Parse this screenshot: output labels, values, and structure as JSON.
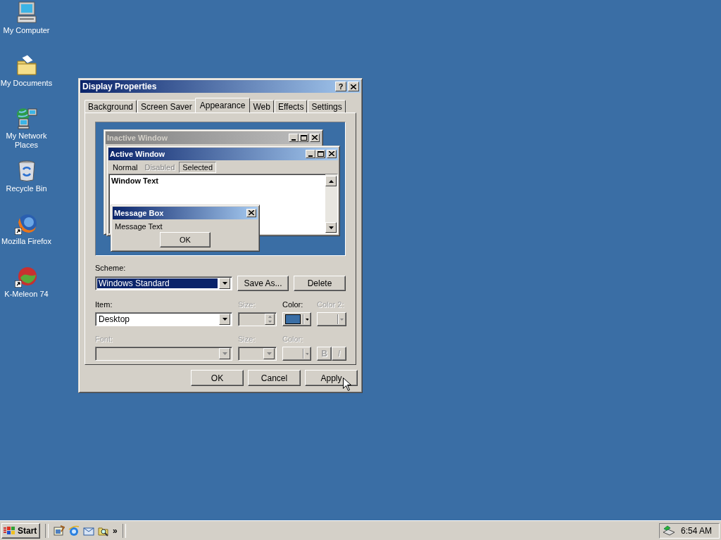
{
  "desktop_icons": [
    {
      "label": "My Computer",
      "kind": "computer",
      "shortcut": false
    },
    {
      "label": "My Documents",
      "kind": "documents",
      "shortcut": false
    },
    {
      "label": "My Network Places",
      "kind": "network",
      "shortcut": false
    },
    {
      "label": "Recycle Bin",
      "kind": "recycle",
      "shortcut": false
    },
    {
      "label": "Mozilla Firefox",
      "kind": "firefox",
      "shortcut": true
    },
    {
      "label": "K-Meleon 74",
      "kind": "kmeleon",
      "shortcut": true
    }
  ],
  "dialog": {
    "title": "Display Properties",
    "help": "?",
    "tabs": [
      {
        "label": "Background",
        "selected": false
      },
      {
        "label": "Screen Saver",
        "selected": false
      },
      {
        "label": "Appearance",
        "selected": true
      },
      {
        "label": "Web",
        "selected": false
      },
      {
        "label": "Effects",
        "selected": false
      },
      {
        "label": "Settings",
        "selected": false
      }
    ],
    "preview": {
      "inactive_title": "Inactive Window",
      "active_title": "Active Window",
      "menu": [
        {
          "label": "Normal",
          "disabled": false,
          "selected": false
        },
        {
          "label": "Disabled",
          "disabled": true,
          "selected": false
        },
        {
          "label": "Selected",
          "disabled": false,
          "selected": true
        }
      ],
      "window_text": "Window Text",
      "message_title": "Message Box",
      "message_text": "Message Text",
      "message_button": "OK"
    },
    "scheme": {
      "label": "Scheme:",
      "value": "Windows Standard",
      "highlighted": true
    },
    "scheme_buttons": [
      "Save As...",
      "Delete"
    ],
    "rows": [
      {
        "fields": [
          {
            "kind": "dropdown",
            "label": "Item:",
            "value": "Desktop",
            "disabled": false
          },
          {
            "kind": "spinner",
            "label": "Size:",
            "disabled": true
          },
          {
            "kind": "color",
            "label": "Color:",
            "color": "#3a6ea5",
            "disabled": false
          },
          {
            "kind": "color",
            "label": "Color 2:",
            "disabled": true
          }
        ]
      },
      {
        "fields": [
          {
            "kind": "dropdown",
            "label": "Font:",
            "disabled": true
          },
          {
            "kind": "dropdown",
            "label": "Size:",
            "disabled": true
          },
          {
            "kind": "color",
            "label": "Color:",
            "disabled": true
          },
          {
            "kind": "style_buttons",
            "buttons": [
              "B",
              "I"
            ],
            "disabled": true
          }
        ]
      }
    ],
    "buttons": [
      "OK",
      "Cancel",
      "Apply"
    ]
  },
  "taskbar": {
    "start": "Start",
    "quick_launch": [
      {
        "kind": "desktop"
      },
      {
        "kind": "browser"
      },
      {
        "kind": "mail"
      },
      {
        "kind": "search"
      }
    ],
    "more": "»",
    "clock": "6:54 AM"
  }
}
